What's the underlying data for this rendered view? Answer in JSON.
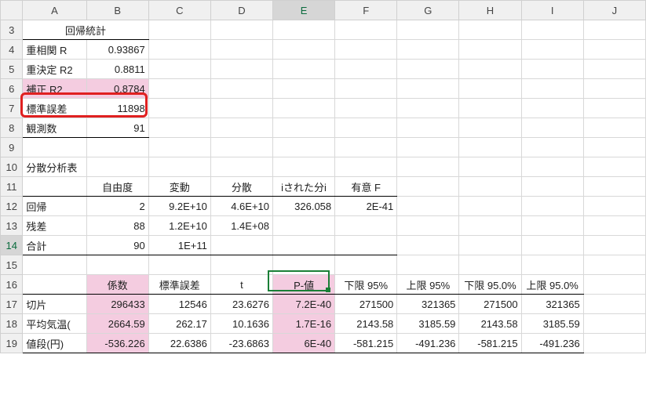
{
  "columns": [
    "A",
    "B",
    "C",
    "D",
    "E",
    "F",
    "G",
    "H",
    "I",
    "J"
  ],
  "rows": [
    "3",
    "4",
    "5",
    "6",
    "7",
    "8",
    "9",
    "10",
    "11",
    "12",
    "13",
    "14",
    "15",
    "16",
    "17",
    "18",
    "19"
  ],
  "selected_col": "E",
  "selected_row": "14",
  "cells": {
    "r3": {
      "A": "回帰統計"
    },
    "r4": {
      "A": "重相関 R",
      "B": "0.93867"
    },
    "r5": {
      "A": "重決定 R2",
      "B": "0.8811"
    },
    "r6": {
      "A": "補正 R2",
      "B": "0.8784"
    },
    "r7": {
      "A": "標準誤差",
      "B": "11898"
    },
    "r8": {
      "A": "観測数",
      "B": "91"
    },
    "r10": {
      "A": "分散分析表"
    },
    "r11": {
      "B": "自由度",
      "C": "変動",
      "D": "分散",
      "E": "iされた分i",
      "F": "有意 F"
    },
    "r12": {
      "A": "回帰",
      "B": "2",
      "C": "9.2E+10",
      "D": "4.6E+10",
      "E": "326.058",
      "F": "2E-41"
    },
    "r13": {
      "A": "残差",
      "B": "88",
      "C": "1.2E+10",
      "D": "1.4E+08"
    },
    "r14": {
      "A": "合計",
      "B": "90",
      "C": "1E+11"
    },
    "r16": {
      "B": "係数",
      "C": "標準誤差",
      "D": "t",
      "E": "P-値",
      "F": "下限 95%",
      "G": "上限 95%",
      "H": "下限 95.0%",
      "I": "上限 95.0%"
    },
    "r17": {
      "A": "切片",
      "B": "296433",
      "C": "12546",
      "D": "23.6276",
      "E": "7.2E-40",
      "F": "271500",
      "G": "321365",
      "H": "271500",
      "I": "321365"
    },
    "r18": {
      "A": "平均気温(",
      "B": "2664.59",
      "C": "262.17",
      "D": "10.1636",
      "E": "1.7E-16",
      "F": "2143.58",
      "G": "3185.59",
      "H": "2143.58",
      "I": "3185.59"
    },
    "r19": {
      "A": "値段(円)",
      "B": "-536.226",
      "C": "22.6386",
      "D": "-23.6863",
      "E": "6E-40",
      "F": "-581.215",
      "G": "-491.236",
      "H": "-581.215",
      "I": "-491.236"
    }
  },
  "chart_data": {
    "type": "table",
    "title": "回帰統計 / 分散分析表 / 係数 (Linear Regression Output)",
    "regression_stats": {
      "重相関 R": 0.93867,
      "重決定 R2": 0.8811,
      "補正 R2": 0.8784,
      "標準誤差": 11898,
      "観測数": 91
    },
    "anova": {
      "columns": [
        "自由度",
        "変動",
        "分散",
        "観測された分散比",
        "有意 F"
      ],
      "rows": {
        "回帰": [
          2,
          92000000000.0,
          46000000000.0,
          326.058,
          2e-41
        ],
        "残差": [
          88,
          12000000000.0,
          140000000.0,
          null,
          null
        ],
        "合計": [
          90,
          100000000000.0,
          null,
          null,
          null
        ]
      }
    },
    "coefficients": {
      "columns": [
        "係数",
        "標準誤差",
        "t",
        "P-値",
        "下限 95%",
        "上限 95%",
        "下限 95.0%",
        "上限 95.0%"
      ],
      "rows": {
        "切片": [
          296433,
          12546,
          23.6276,
          7.2e-40,
          271500,
          321365,
          271500,
          321365
        ],
        "平均気温": [
          2664.59,
          262.17,
          10.1636,
          1.7e-16,
          2143.58,
          3185.59,
          2143.58,
          3185.59
        ],
        "値段(円)": [
          -536.226,
          22.6386,
          -23.6863,
          6e-40,
          -581.215,
          -491.236,
          -581.215,
          -491.236
        ]
      }
    }
  }
}
